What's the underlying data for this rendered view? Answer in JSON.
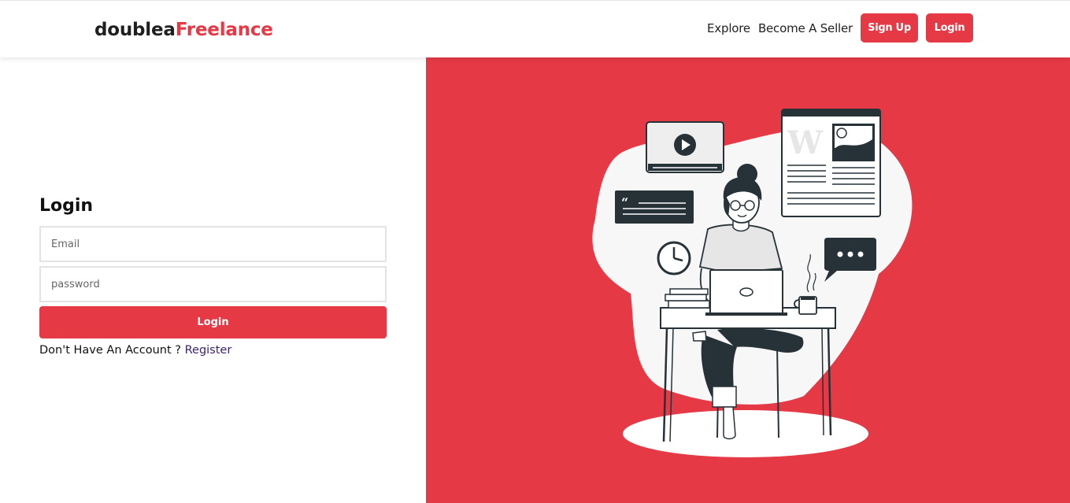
{
  "header": {
    "brand_part1": "doublea",
    "brand_part2": "Freelance",
    "nav": {
      "explore": "Explore",
      "become_seller": "Become A Seller",
      "signup": "Sign Up",
      "login": "Login"
    }
  },
  "form": {
    "title": "Login",
    "email_placeholder": "Email",
    "password_placeholder": "password",
    "submit_label": "Login",
    "no_account_text": "Don't Have An Account ?",
    "register_link": "Register"
  },
  "illustration": {
    "newspaper_letter": "W"
  },
  "colors": {
    "accent": "#e63946",
    "dark": "#263238",
    "link": "#3d2472"
  }
}
